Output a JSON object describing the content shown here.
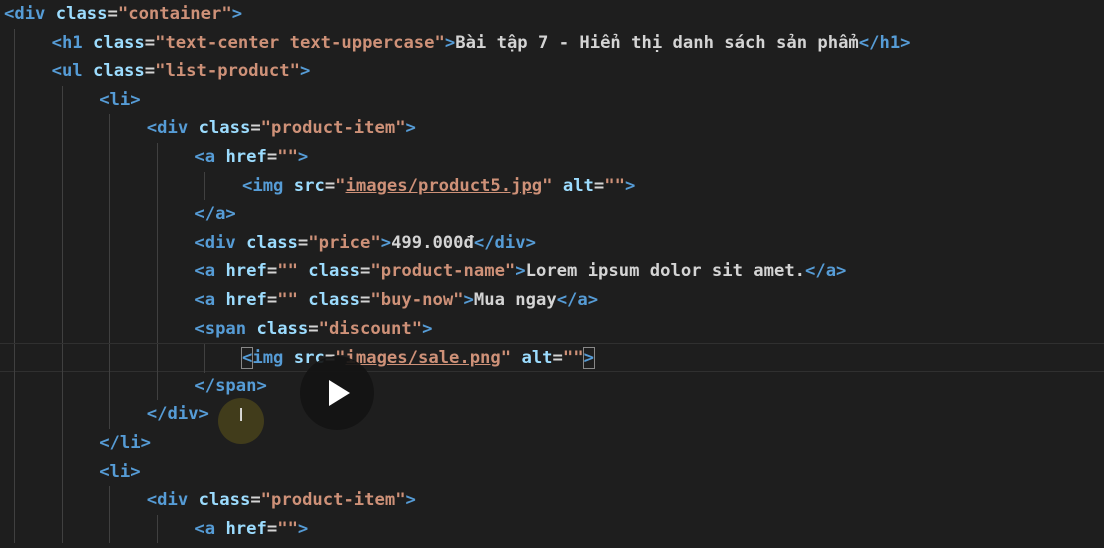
{
  "editor": {
    "lines": [
      {
        "indent": 0,
        "tokens": [
          [
            "tag",
            "<div"
          ],
          [
            "txt",
            " "
          ],
          [
            "attr",
            "class"
          ],
          [
            "eq",
            "="
          ],
          [
            "str",
            "\"container\""
          ],
          [
            "tag",
            ">"
          ]
        ]
      },
      {
        "indent": 1,
        "tokens": [
          [
            "tag",
            "<h1"
          ],
          [
            "txt",
            " "
          ],
          [
            "attr",
            "class"
          ],
          [
            "eq",
            "="
          ],
          [
            "str",
            "\"text-center text-uppercase\""
          ],
          [
            "tag",
            ">"
          ],
          [
            "txt",
            "Bài tập 7 - Hiển thị danh sách sản phẩm"
          ],
          [
            "tag",
            "</h1>"
          ]
        ]
      },
      {
        "indent": 1,
        "tokens": [
          [
            "tag",
            "<ul"
          ],
          [
            "txt",
            " "
          ],
          [
            "attr",
            "class"
          ],
          [
            "eq",
            "="
          ],
          [
            "str",
            "\"list-product\""
          ],
          [
            "tag",
            ">"
          ]
        ]
      },
      {
        "indent": 2,
        "tokens": [
          [
            "tag",
            "<li>"
          ]
        ]
      },
      {
        "indent": 3,
        "tokens": [
          [
            "tag",
            "<div"
          ],
          [
            "txt",
            " "
          ],
          [
            "attr",
            "class"
          ],
          [
            "eq",
            "="
          ],
          [
            "str",
            "\"product-item\""
          ],
          [
            "tag",
            ">"
          ]
        ]
      },
      {
        "indent": 4,
        "tokens": [
          [
            "tag",
            "<a"
          ],
          [
            "txt",
            " "
          ],
          [
            "attr",
            "href"
          ],
          [
            "eq",
            "="
          ],
          [
            "str",
            "\"\""
          ],
          [
            "tag",
            ">"
          ]
        ]
      },
      {
        "indent": 5,
        "tokens": [
          [
            "tag",
            "<img"
          ],
          [
            "txt",
            " "
          ],
          [
            "attr",
            "src"
          ],
          [
            "eq",
            "="
          ],
          [
            "str",
            "\""
          ],
          [
            "link",
            "images/product5.jpg"
          ],
          [
            "str",
            "\""
          ],
          [
            "txt",
            " "
          ],
          [
            "attr",
            "alt"
          ],
          [
            "eq",
            "="
          ],
          [
            "str",
            "\"\""
          ],
          [
            "tag",
            ">"
          ]
        ]
      },
      {
        "indent": 4,
        "tokens": [
          [
            "tag",
            "</a>"
          ]
        ]
      },
      {
        "indent": 4,
        "tokens": [
          [
            "tag",
            "<div"
          ],
          [
            "txt",
            " "
          ],
          [
            "attr",
            "class"
          ],
          [
            "eq",
            "="
          ],
          [
            "str",
            "\"price\""
          ],
          [
            "tag",
            ">"
          ],
          [
            "txt",
            "499.000đ"
          ],
          [
            "tag",
            "</div>"
          ]
        ]
      },
      {
        "indent": 4,
        "tokens": [
          [
            "tag",
            "<a"
          ],
          [
            "txt",
            " "
          ],
          [
            "attr",
            "href"
          ],
          [
            "eq",
            "="
          ],
          [
            "str",
            "\"\""
          ],
          [
            "txt",
            " "
          ],
          [
            "attr",
            "class"
          ],
          [
            "eq",
            "="
          ],
          [
            "str",
            "\"product-name\""
          ],
          [
            "tag",
            ">"
          ],
          [
            "txt",
            "Lorem ipsum dolor sit amet."
          ],
          [
            "tag",
            "</a>"
          ]
        ]
      },
      {
        "indent": 4,
        "tokens": [
          [
            "tag",
            "<a"
          ],
          [
            "txt",
            " "
          ],
          [
            "attr",
            "href"
          ],
          [
            "eq",
            "="
          ],
          [
            "str",
            "\"\""
          ],
          [
            "txt",
            " "
          ],
          [
            "attr",
            "class"
          ],
          [
            "eq",
            "="
          ],
          [
            "str",
            "\"buy-now\""
          ],
          [
            "tag",
            ">"
          ],
          [
            "txt",
            "Mua ngay"
          ],
          [
            "tag",
            "</a>"
          ]
        ]
      },
      {
        "indent": 4,
        "tokens": [
          [
            "tag",
            "<span"
          ],
          [
            "txt",
            " "
          ],
          [
            "attr",
            "class"
          ],
          [
            "eq",
            "="
          ],
          [
            "str",
            "\"discount\""
          ],
          [
            "tag",
            ">"
          ]
        ]
      },
      {
        "indent": 5,
        "cursor": true,
        "tokens": [
          [
            "tagbox",
            "<"
          ],
          [
            "tag",
            "img"
          ],
          [
            "txt",
            " "
          ],
          [
            "attr",
            "src"
          ],
          [
            "eq",
            "="
          ],
          [
            "str",
            "\""
          ],
          [
            "link",
            "images/sale.png"
          ],
          [
            "str",
            "\""
          ],
          [
            "txt",
            " "
          ],
          [
            "attr",
            "alt"
          ],
          [
            "eq",
            "="
          ],
          [
            "str",
            "\"\""
          ],
          [
            "tagbox",
            ">"
          ]
        ]
      },
      {
        "indent": 4,
        "tokens": [
          [
            "tag",
            "</span>"
          ]
        ]
      },
      {
        "indent": 3,
        "tokens": [
          [
            "tag",
            "</div>"
          ]
        ]
      },
      {
        "indent": 2,
        "tokens": [
          [
            "tag",
            "</li>"
          ]
        ]
      },
      {
        "indent": 2,
        "tokens": [
          [
            "tag",
            "<li>"
          ]
        ]
      },
      {
        "indent": 3,
        "tokens": [
          [
            "tag",
            "<div"
          ],
          [
            "txt",
            " "
          ],
          [
            "attr",
            "class"
          ],
          [
            "eq",
            "="
          ],
          [
            "str",
            "\"product-item\""
          ],
          [
            "tag",
            ">"
          ]
        ]
      },
      {
        "indent": 4,
        "tokens": [
          [
            "tag",
            "<a"
          ],
          [
            "txt",
            " "
          ],
          [
            "attr",
            "href"
          ],
          [
            "eq",
            "="
          ],
          [
            "str",
            "\"\""
          ],
          [
            "tag",
            ">"
          ]
        ]
      }
    ]
  },
  "overlay": {
    "play_icon": "play-icon",
    "mouse_cursor_icon": "i-beam-cursor-icon",
    "ibeam_glyph": "I"
  },
  "colors": {
    "background": "#1e1e1e",
    "tag": "#569cd6",
    "attribute": "#9cdcfe",
    "string": "#ce9178",
    "text": "#d4d4d4"
  }
}
